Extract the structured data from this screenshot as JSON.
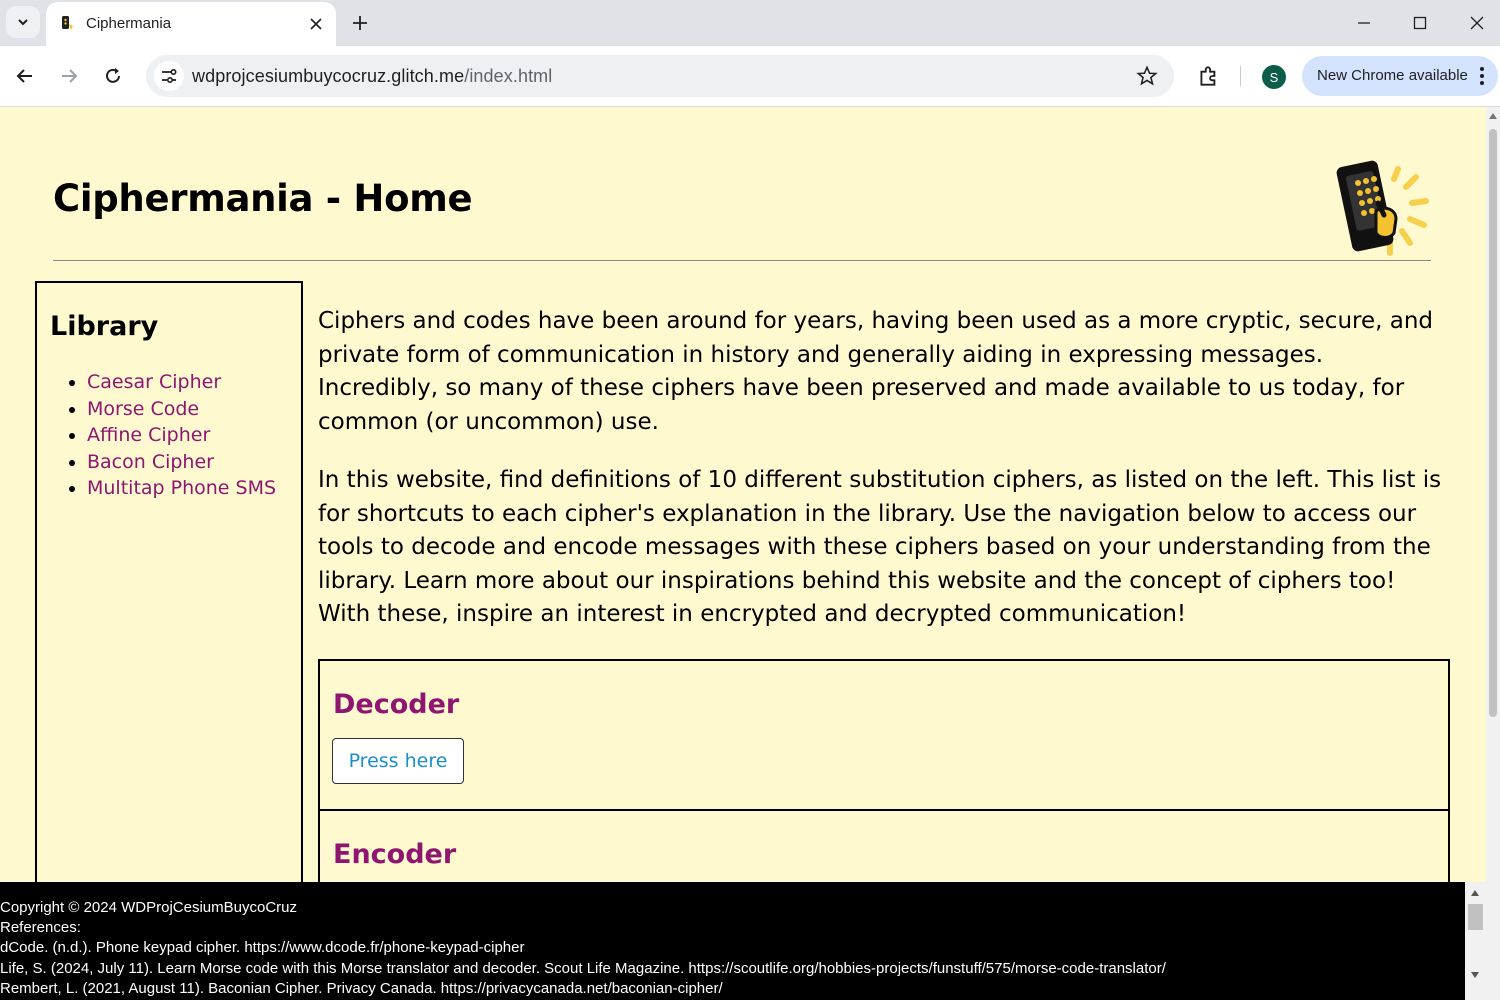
{
  "browser": {
    "tab": {
      "title": "Ciphermania",
      "favicon": "ciphermania-favicon"
    },
    "url": {
      "host": "wdprojcesiumbuycocruz.glitch.me",
      "path": "/index.html"
    },
    "profile_initial": "S",
    "update_chip_label": "New Chrome available",
    "colors": {
      "tabbar": "#dfe3e8",
      "omnibox": "#eef1f4",
      "update_chip": "#d3e3fd",
      "avatar": "#0b5d4a"
    }
  },
  "page": {
    "title": "Ciphermania - Home",
    "colors": {
      "background": "#fff9d0",
      "link": "#8e1670",
      "button_text": "#1a8fc9"
    },
    "sidebar": {
      "heading": "Library",
      "items": [
        {
          "label": "Caesar Cipher"
        },
        {
          "label": "Morse Code"
        },
        {
          "label": "Affine Cipher"
        },
        {
          "label": "Bacon Cipher"
        },
        {
          "label": "Multitap Phone SMS"
        }
      ]
    },
    "intro": [
      "Ciphers and codes have been around for years, having been used as a more cryptic, secure, and private form of communication in history and generally aiding in expressing messages. Incredibly, so many of these ciphers have been preserved and made available to us today, for common (or uncommon) use.",
      "In this website, find definitions of 10 different substitution ciphers, as listed on the left. This list is for shortcuts to each cipher's explanation in the library. Use the navigation below to access our tools to decode and encode messages with these ciphers based on your understanding from the library. Learn more about our inspirations behind this website and the concept of ciphers too! With these, inspire an interest in encrypted and decrypted communication!"
    ],
    "decoder": {
      "heading": "Decoder",
      "button": "Press here"
    },
    "encoder": {
      "heading": "Encoder"
    }
  },
  "footer": {
    "lines": [
      "Copyright © 2024 WDProjCesiumBuycoCruz",
      "References:",
      "dCode. (n.d.). Phone keypad cipher. https://www.dcode.fr/phone-keypad-cipher",
      "Life, S. (2024, July 11). Learn Morse code with this Morse translator and decoder. Scout Life Magazine. https://scoutlife.org/hobbies-projects/funstuff/575/morse-code-translator/",
      "Rembert, L. (2021, August 11). Baconian Cipher. Privacy Canada. https://privacycanada.net/baconian-cipher/"
    ]
  }
}
